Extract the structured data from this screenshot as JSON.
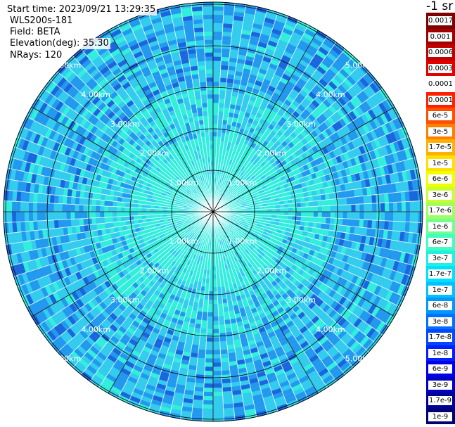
{
  "info": {
    "start_time": "Start time: 2023/09/21 13:29:35",
    "device": "WLS200s-181",
    "field": "Field: BETA",
    "elevation": "Elevation(deg): 35.30",
    "nrays": "NRays: 120"
  },
  "unit_label": "-1 sr",
  "range_rings": [
    {
      "label": "1.00km",
      "range_km": 1
    },
    {
      "label": "2.00km",
      "range_km": 2
    },
    {
      "label": "3.00km",
      "range_km": 3
    },
    {
      "label": "4.00km",
      "range_km": 4
    },
    {
      "label": "5.00km",
      "range_km": 5
    }
  ],
  "colorbar": {
    "entries": [
      {
        "label": "0.0017",
        "color": "#800000"
      },
      {
        "label": "0.001",
        "color": "#a00000"
      },
      {
        "label": "0.0006",
        "color": "#c00000"
      },
      {
        "label": "0.0003",
        "color": "#e00000"
      },
      {
        "label": "0.00017",
        "color": "#ffffff"
      },
      {
        "label": "0.0001",
        "color": "#ff2000"
      },
      {
        "label": "6e-5",
        "color": "#ff5000"
      },
      {
        "label": "3e-5",
        "color": "#ff8000"
      },
      {
        "label": "1.7e-5",
        "color": "#ffb000"
      },
      {
        "label": "1e-5",
        "color": "#ffe000"
      },
      {
        "label": "6e-6",
        "color": "#f0ff00"
      },
      {
        "label": "3e-6",
        "color": "#c8ff30"
      },
      {
        "label": "1.7e-6",
        "color": "#a0ff60"
      },
      {
        "label": "1e-6",
        "color": "#70ff90"
      },
      {
        "label": "6e-7",
        "color": "#40ffc0"
      },
      {
        "label": "3e-7",
        "color": "#20f0e0"
      },
      {
        "label": "1.7e-7",
        "color": "#00e0ff"
      },
      {
        "label": "1e-7",
        "color": "#00c0ff"
      },
      {
        "label": "6e-8",
        "color": "#0098ff"
      },
      {
        "label": "3e-8",
        "color": "#0070ff"
      },
      {
        "label": "1.7e-8",
        "color": "#0048ff"
      },
      {
        "label": "1e-8",
        "color": "#0020ff"
      },
      {
        "label": "6e-9",
        "color": "#0000e8"
      },
      {
        "label": "3e-9",
        "color": "#0000c0"
      },
      {
        "label": "1.7e-9",
        "color": "#000098"
      },
      {
        "label": "1e-9",
        "color": "#000070"
      }
    ]
  },
  "colors": {
    "near_field": "#33eedd",
    "mid_field": "#33ccee",
    "far_field": "#2299ee",
    "dark_patch": "#1a66dd",
    "grid": "#000000"
  }
}
